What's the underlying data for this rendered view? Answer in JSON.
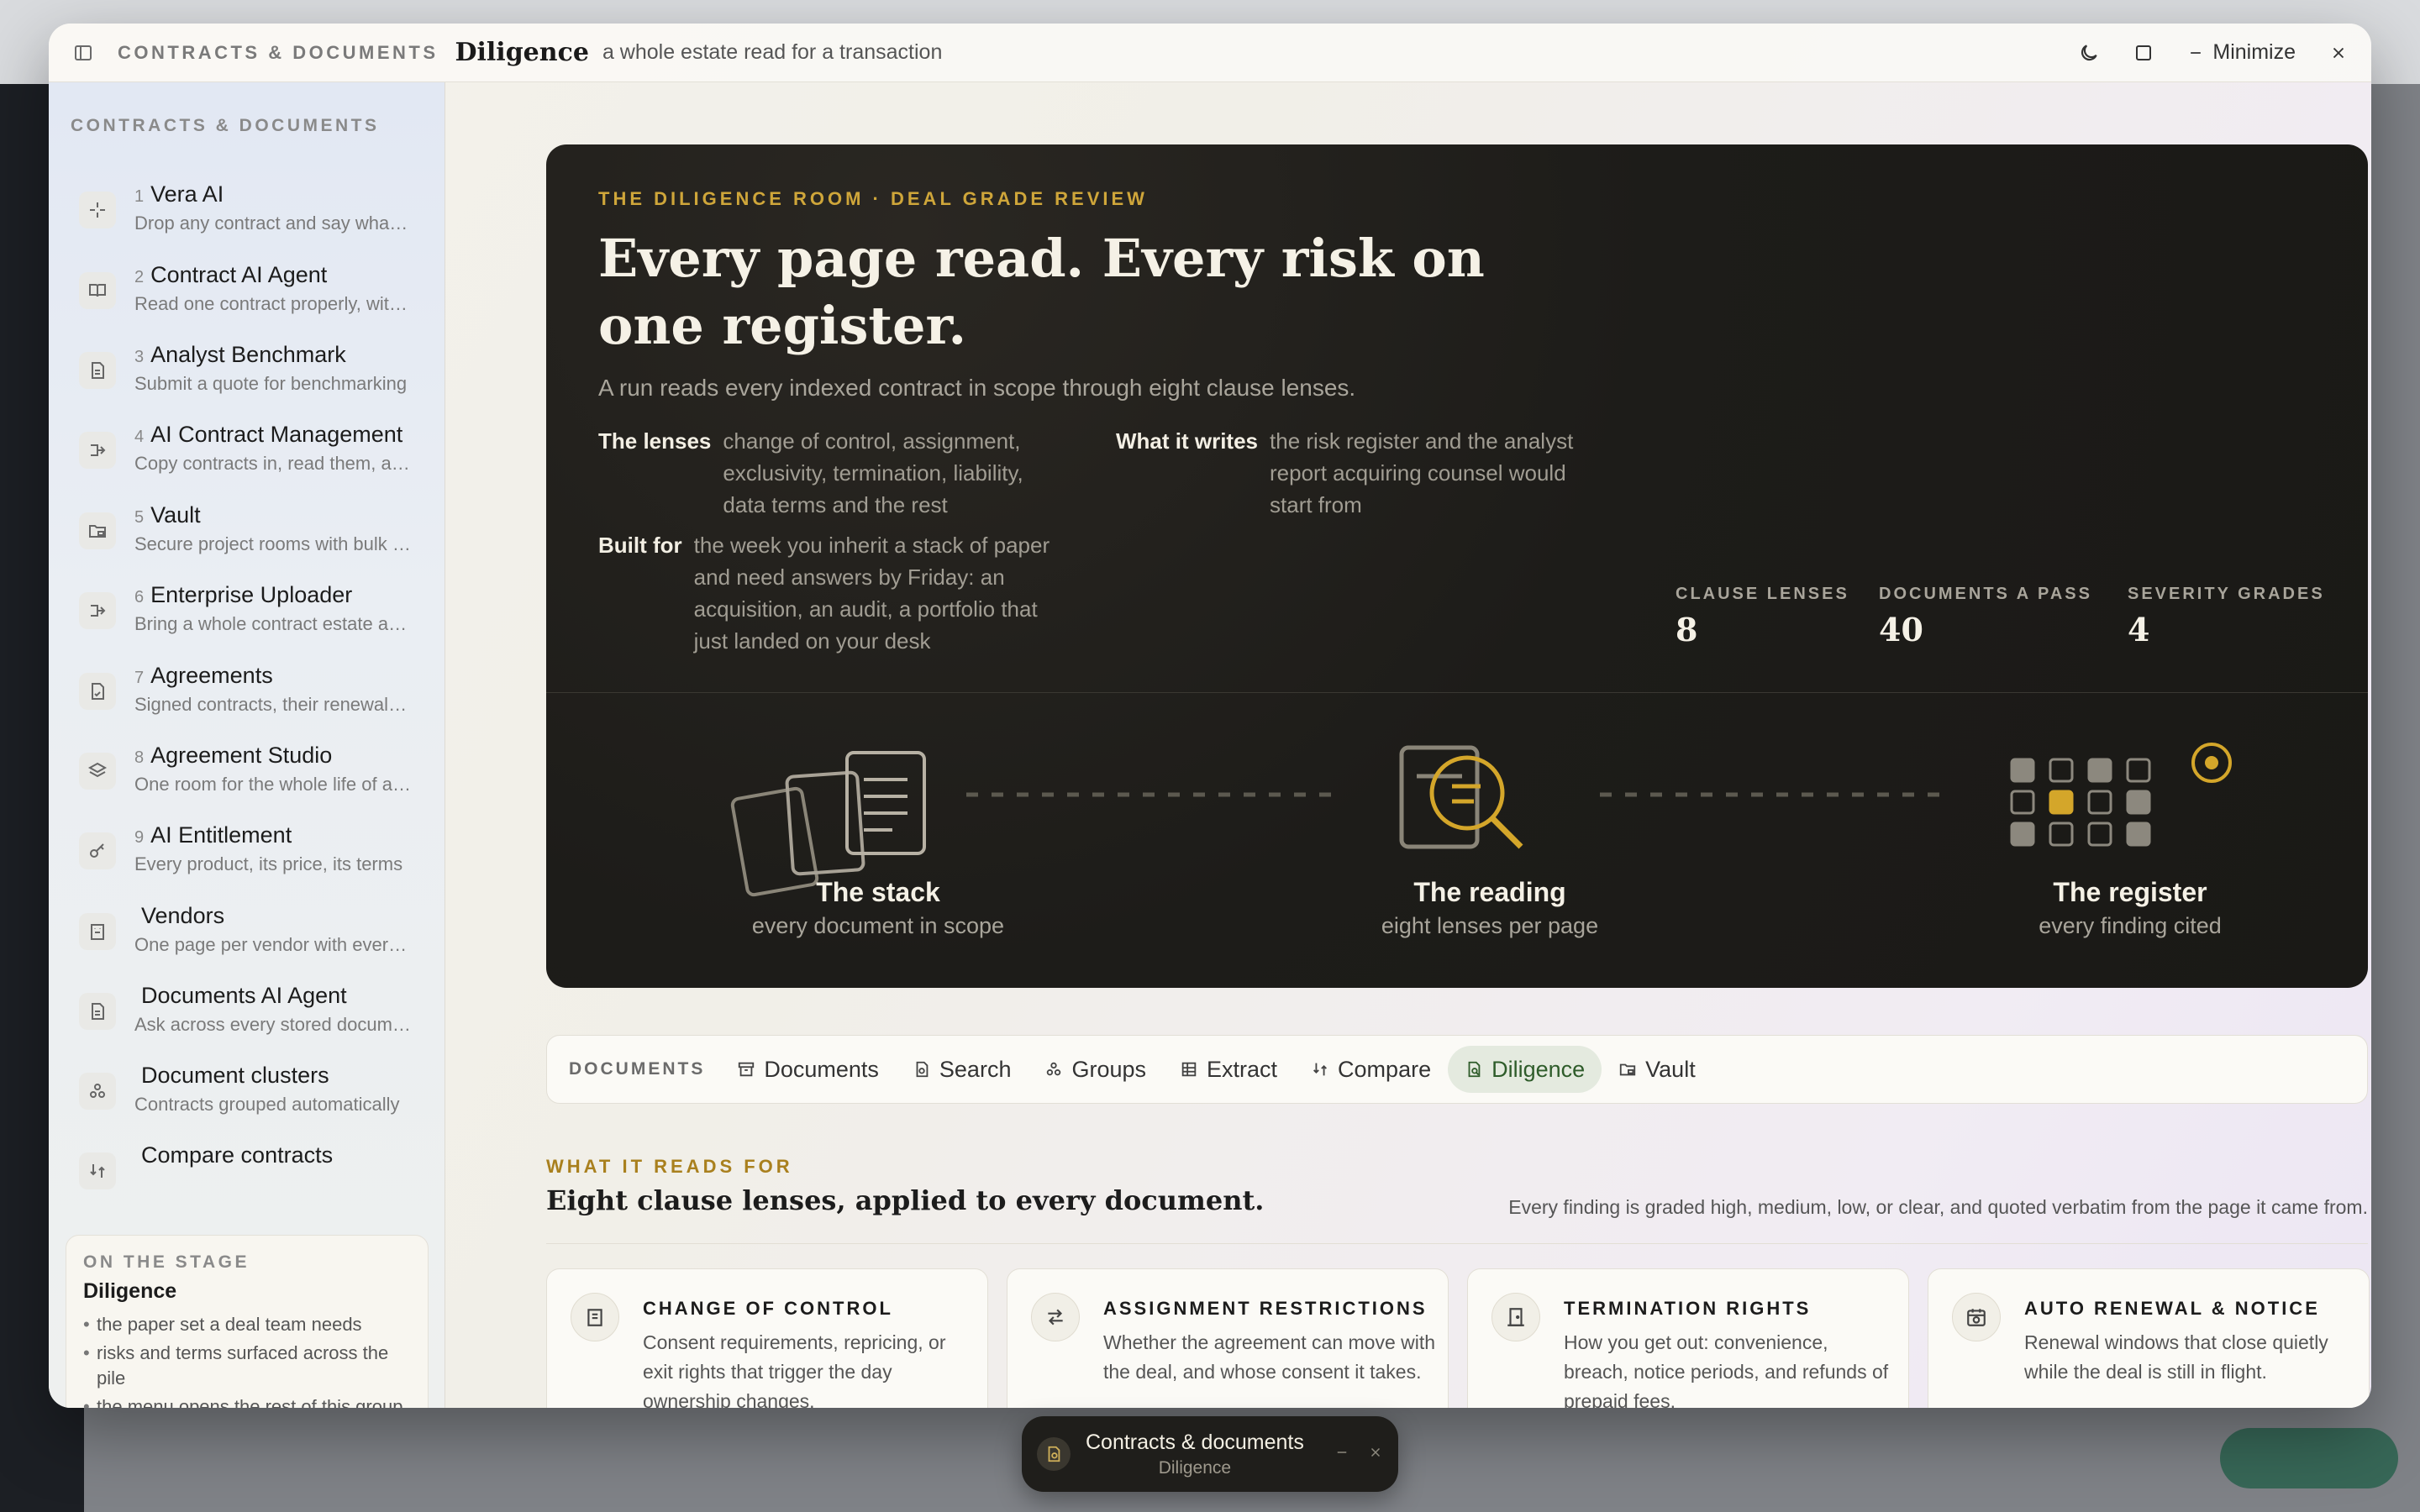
{
  "window": {
    "group": "CONTRACTS & DOCUMENTS",
    "title": "Diligence",
    "subtitle": "a whole estate read for a transaction",
    "minimize_label": "Minimize"
  },
  "sidebar": {
    "heading": "CONTRACTS & DOCUMENTS",
    "items": [
      {
        "num": "1",
        "name": "Vera AI",
        "desc": "Drop any contract and say what you need",
        "icon": "sparkle-icon"
      },
      {
        "num": "2",
        "name": "Contract AI Agent",
        "desc": "Read one contract properly, with citations",
        "icon": "book-icon"
      },
      {
        "num": "3",
        "name": "Analyst Benchmark",
        "desc": "Submit a quote for benchmarking",
        "icon": "document-icon"
      },
      {
        "num": "4",
        "name": "AI Contract Management",
        "desc": "Copy contracts in, read them, and manage",
        "icon": "flow-icon"
      },
      {
        "num": "5",
        "name": "Vault",
        "desc": "Secure project rooms with bulk upload",
        "icon": "folder-lock-icon"
      },
      {
        "num": "6",
        "name": "Enterprise Uploader",
        "desc": "Bring a whole contract estate across",
        "icon": "flow-icon"
      },
      {
        "num": "7",
        "name": "Agreements",
        "desc": "Signed contracts, their renewal dates",
        "icon": "signed-doc-icon"
      },
      {
        "num": "8",
        "name": "Agreement Studio",
        "desc": "One room for the whole life of an agreement",
        "icon": "layers-icon"
      },
      {
        "num": "9",
        "name": "AI Entitlement",
        "desc": "Every product, its price, its terms",
        "icon": "key-icon"
      },
      {
        "num": "",
        "name": "Vendors",
        "desc": "One page per vendor with everything",
        "icon": "building-icon"
      },
      {
        "num": "",
        "name": "Documents AI Agent",
        "desc": "Ask across every stored document",
        "icon": "document-icon"
      },
      {
        "num": "",
        "name": "Document clusters",
        "desc": "Contracts grouped automatically",
        "icon": "cluster-icon"
      },
      {
        "num": "",
        "name": "Compare contracts",
        "desc": "",
        "icon": "compare-icon"
      }
    ],
    "stage": {
      "label": "ON THE STAGE",
      "title": "Diligence",
      "points": [
        "the paper set a deal team needs",
        "risks and terms surfaced across the pile",
        "the menu opens the rest of this group"
      ]
    }
  },
  "hero": {
    "eyebrow": "THE DILIGENCE ROOM · DEAL GRADE REVIEW",
    "title": "Every page read. Every risk on one register.",
    "lede": "A run reads every indexed contract in scope through eight clause lenses.",
    "lenses_key": "The lenses",
    "lenses_value": "change of control, assignment, exclusivity, termination, liability, data terms and the rest",
    "writes_key": "What it writes",
    "writes_value": "the risk register and the analyst report acquiring counsel would start from",
    "built_key": "Built for",
    "built_value": "the week you inherit a stack of paper and need answers by Friday: an acquisition, an audit, a portfolio that just landed on your desk",
    "stats": [
      {
        "label": "CLAUSE LENSES",
        "value": "8"
      },
      {
        "label": "DOCUMENTS A PASS",
        "value": "40"
      },
      {
        "label": "SEVERITY GRADES",
        "value": "4"
      }
    ],
    "stages": [
      {
        "name": "The stack",
        "caption": "every document in scope"
      },
      {
        "name": "The reading",
        "caption": "eight lenses per page"
      },
      {
        "name": "The register",
        "caption": "every finding cited"
      }
    ],
    "accent": "#d4a62a"
  },
  "tabs": {
    "label": "DOCUMENTS",
    "items": [
      {
        "label": "Documents",
        "icon": "archive-icon",
        "active": false
      },
      {
        "label": "Search",
        "icon": "search-doc-icon",
        "active": false
      },
      {
        "label": "Groups",
        "icon": "groups-icon",
        "active": false
      },
      {
        "label": "Extract",
        "icon": "grid-icon",
        "active": false
      },
      {
        "label": "Compare",
        "icon": "compare-icon",
        "active": false
      },
      {
        "label": "Diligence",
        "icon": "diligence-icon",
        "active": true
      },
      {
        "label": "Vault",
        "icon": "folder-lock-icon",
        "active": false
      }
    ]
  },
  "lenses": {
    "eyebrow": "WHAT IT READS FOR",
    "title": "Eight clause lenses, applied to every document.",
    "note": "Every finding is graded high, medium, low, or clear, and quoted verbatim from the page it came from.",
    "cards": [
      {
        "title": "CHANGE OF CONTROL",
        "body": "Consent requirements, repricing, or exit rights that trigger the day ownership changes.",
        "icon": "building-icon"
      },
      {
        "title": "ASSIGNMENT RESTRICTIONS",
        "body": "Whether the agreement can move with the deal, and whose consent it takes.",
        "icon": "swap-icon"
      },
      {
        "title": "TERMINATION RIGHTS",
        "body": "How you get out: convenience, breach, notice periods, and refunds of prepaid fees.",
        "icon": "door-icon"
      },
      {
        "title": "AUTO RENEWAL & NOTICE",
        "body": "Renewal windows that close quietly while the deal is still in flight.",
        "icon": "calendar-clock-icon"
      }
    ]
  },
  "dock": {
    "title": "Contracts & documents",
    "subtitle": "Diligence"
  }
}
